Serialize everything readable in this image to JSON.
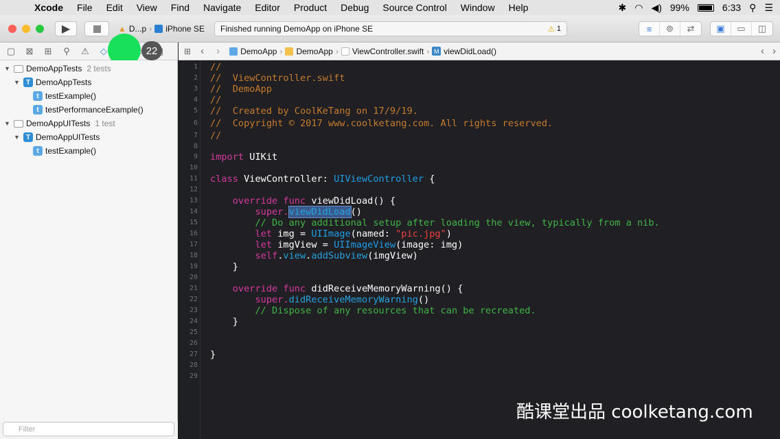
{
  "menubar": {
    "apple_icon": "apple-icon",
    "app": "Xcode",
    "items": [
      "File",
      "Edit",
      "View",
      "Find",
      "Navigate",
      "Editor",
      "Product",
      "Debug",
      "Source Control",
      "Window",
      "Help"
    ],
    "battery": "99%",
    "time": "6:33"
  },
  "toolbar": {
    "scheme_project": "D...p",
    "scheme_device": "iPhone SE",
    "status": "Finished running DemoApp on iPhone SE",
    "warning_count": "1"
  },
  "navigator": {
    "badge": "22",
    "filter_placeholder": "Filter",
    "tree": [
      {
        "label": "DemoAppTests",
        "count": "2 tests"
      },
      {
        "label": "DemoAppTests"
      },
      {
        "label": "testExample()"
      },
      {
        "label": "testPerformanceExample()"
      },
      {
        "label": "DemoAppUITests",
        "count": "1 test"
      },
      {
        "label": "DemoAppUITests"
      },
      {
        "label": "testExample()"
      }
    ]
  },
  "jumpbar": {
    "crumbs": [
      "DemoApp",
      "DemoApp",
      "ViewController.swift",
      "viewDidLoad()"
    ]
  },
  "editor": {
    "line_numbers": [
      "1",
      "2",
      "3",
      "4",
      "5",
      "6",
      "7",
      "8",
      "9",
      "10",
      "11",
      "12",
      "13",
      "14",
      "15",
      "16",
      "17",
      "18",
      "19",
      "20",
      "21",
      "22",
      "23",
      "24",
      "25",
      "26",
      "27",
      "28",
      "29"
    ]
  },
  "code": {
    "l1": "//",
    "l2": "//  ViewController.swift",
    "l3": "//  DemoApp",
    "l4": "//",
    "l5": "//  Created by CoolKeTang on 17/9/19.",
    "l6": "//  Copyright © 2017 www.coolketang.com. All rights reserved.",
    "l7": "//",
    "import_kw": "import",
    "import_mod": " UIKit",
    "class_kw": "class",
    "class_name": " ViewController: ",
    "class_super": "UIViewController",
    "class_open": " {",
    "ovr1": "    override func",
    "ovr1_name": " viewDidLoad() {",
    "super1": "        super.",
    "super1_call": "viewDidLoad",
    "super1_end": "()",
    "comment15": "        // Do any additional setup after loading the view, typically from a nib.",
    "let1": "        let",
    "let1_a": " img = ",
    "let1_type": "UIImage",
    "let1_b": "(named: ",
    "let1_str": "\"pic.jpg\"",
    "let1_c": ")",
    "let2": "        let",
    "let2_a": " imgView = ",
    "let2_type": "UIImageView",
    "let2_b": "(image: img)",
    "self_kw": "        self",
    "self_dot": ".",
    "self_view": "view",
    "self_dot2": ".",
    "self_add": "addSubview",
    "self_end": "(imgView)",
    "close19": "    }",
    "ovr2": "    override func",
    "ovr2_name": " didReceiveMemoryWarning() {",
    "super2": "        super.",
    "super2_call": "didReceiveMemoryWarning",
    "super2_end": "()",
    "comment23": "        // Dispose of any resources that can be recreated.",
    "close24": "    }",
    "close27": "}"
  },
  "watermark": {
    "cn": "酷课堂出品",
    "en": " coolketang.com"
  },
  "colors": {
    "comment_green": "#41b645",
    "header_comment": "#c77c2e",
    "keyword": "#d63aa1",
    "type": "#1fa0e8",
    "string": "#f03f3f",
    "editor_bg": "#1f1f24"
  }
}
